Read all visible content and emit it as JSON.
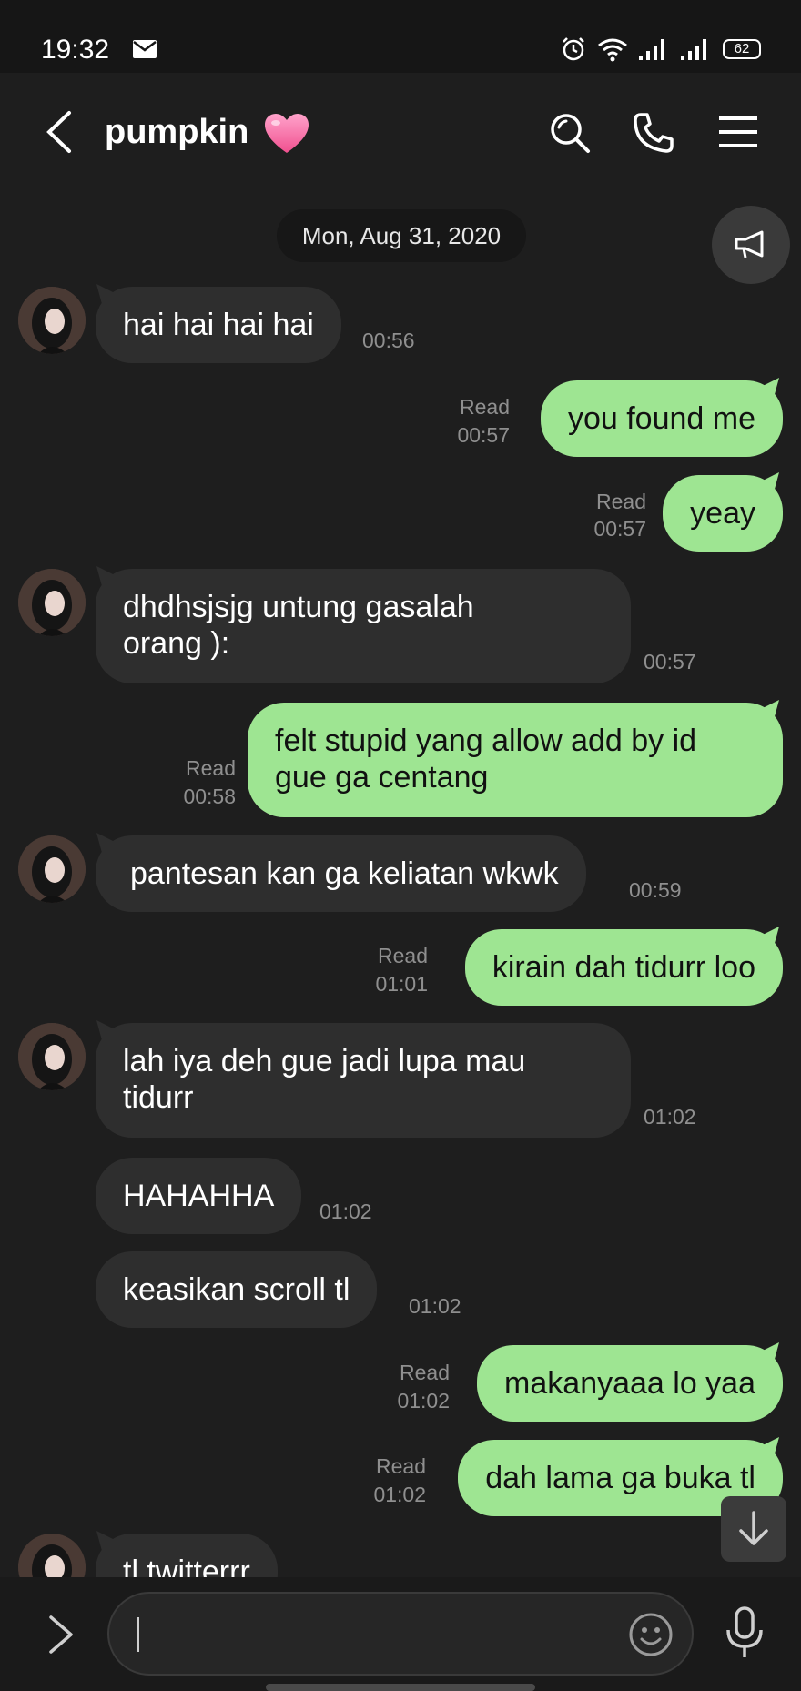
{
  "status_bar": {
    "time": "19:32",
    "battery": "62",
    "icons": [
      "mail-icon",
      "alarm-icon",
      "wifi-icon",
      "signal-icon",
      "signal-icon",
      "battery-icon"
    ]
  },
  "header": {
    "title": "pumpkin",
    "icons": [
      "back-icon",
      "heart-icon",
      "search-icon",
      "call-icon",
      "menu-icon"
    ]
  },
  "date_divider": "Mon, Aug 31, 2020",
  "messages": [
    {
      "dir": "in",
      "lines": [
        "hai hai hai hai"
      ],
      "time": "00:56"
    },
    {
      "dir": "out",
      "lines": [
        "you found me"
      ],
      "read": "Read",
      "time": "00:57"
    },
    {
      "dir": "out",
      "lines": [
        "yeay"
      ],
      "read": "Read",
      "time": "00:57"
    },
    {
      "dir": "in",
      "lines": [
        "dhdhsjsjg untung gasalah",
        "orang ):"
      ],
      "time": "00:57"
    },
    {
      "dir": "out",
      "lines": [
        "felt stupid yang allow add by id",
        "gue ga centang"
      ],
      "read": "Read",
      "time": "00:58"
    },
    {
      "dir": "in",
      "lines": [
        "pantesan kan ga keliatan wkwk"
      ],
      "time": "00:59"
    },
    {
      "dir": "out",
      "lines": [
        "kirain dah tidurr loo"
      ],
      "read": "Read",
      "time": "01:01"
    },
    {
      "dir": "in",
      "lines": [
        "lah iya deh gue jadi lupa mau",
        "tidurr"
      ],
      "time": "01:02"
    },
    {
      "dir": "in",
      "lines": [
        "HAHAHHA"
      ],
      "time": "01:02"
    },
    {
      "dir": "in",
      "lines": [
        "keasikan scroll tl"
      ],
      "time": "01:02"
    },
    {
      "dir": "out",
      "lines": [
        "makanyaaa lo yaa"
      ],
      "read": "Read",
      "time": "01:02"
    },
    {
      "dir": "out",
      "lines": [
        "dah lama ga buka tl"
      ],
      "read": "Read",
      "time": "01:02"
    },
    {
      "dir": "in",
      "lines": [
        "tl twitterrr"
      ],
      "time": ""
    }
  ],
  "input": {
    "value": "",
    "icons": [
      "expand-icon",
      "emoji-icon",
      "mic-icon"
    ]
  },
  "colors": {
    "background": "#1e1e1e",
    "incoming_bubble": "#2e2e2e",
    "outgoing_bubble": "#9ee592",
    "meta_text": "#8f8f8f"
  }
}
